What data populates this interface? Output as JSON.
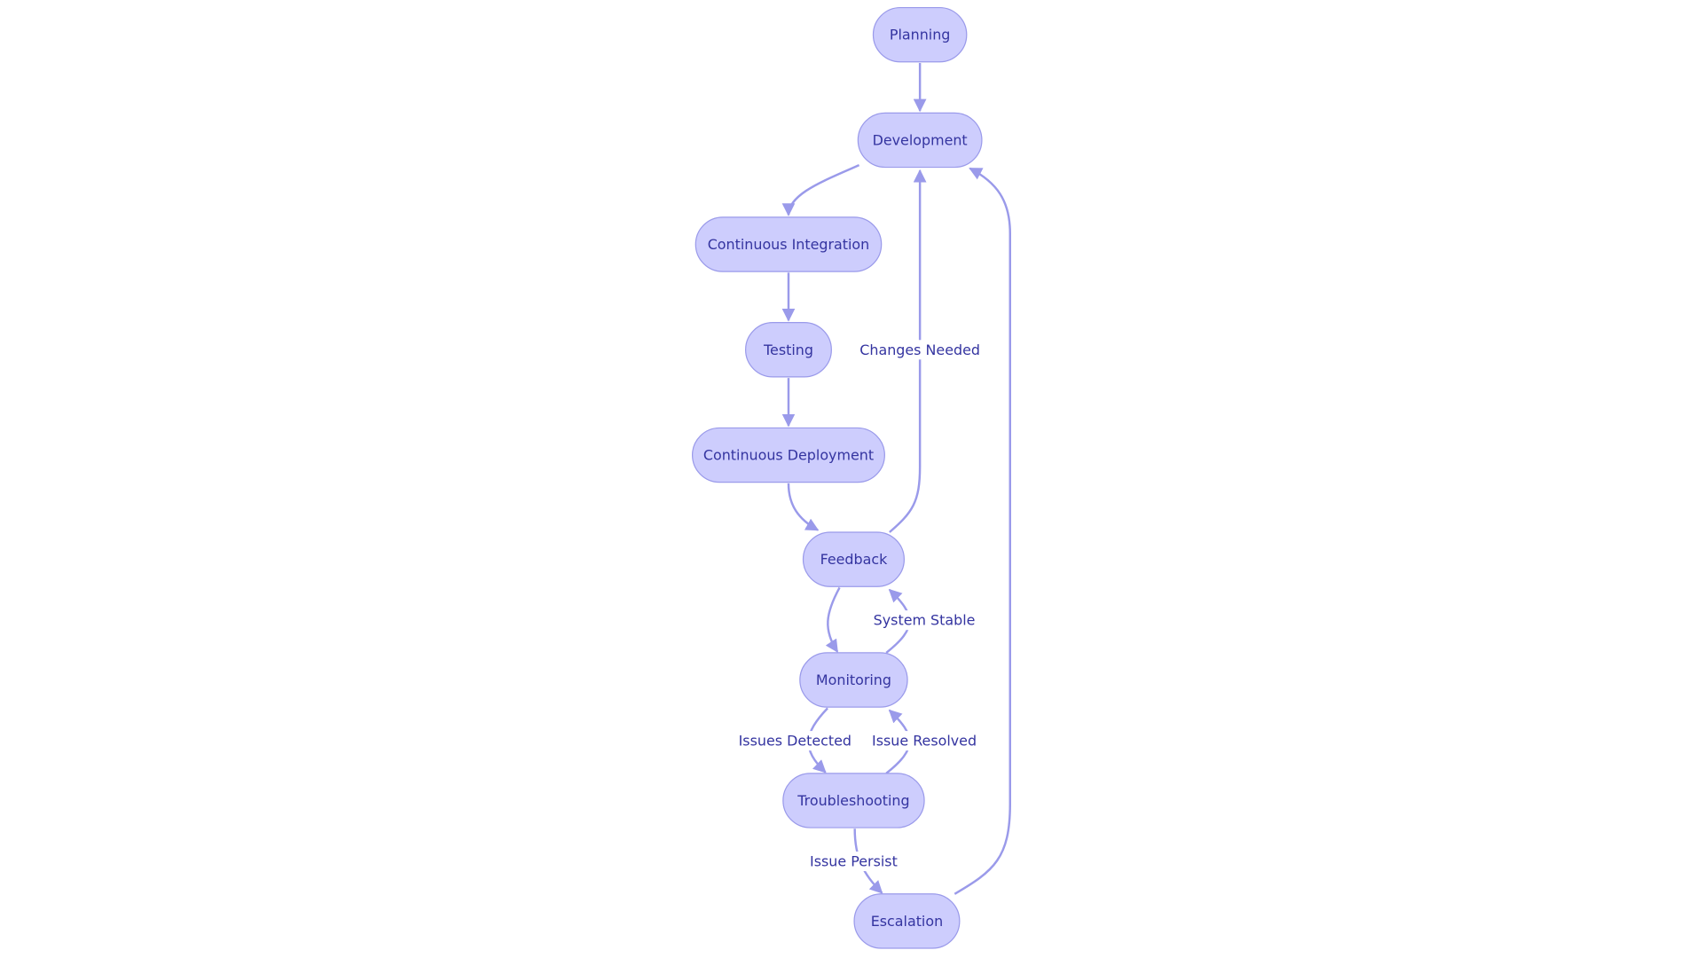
{
  "colors": {
    "node_fill": "#cdcdfd",
    "node_stroke": "#9a9aea",
    "text": "#3434a0",
    "edge": "#9a9aea"
  },
  "nodes": [
    {
      "id": "planning",
      "label": "Planning"
    },
    {
      "id": "development",
      "label": "Development"
    },
    {
      "id": "ci",
      "label": "Continuous Integration"
    },
    {
      "id": "testing",
      "label": "Testing"
    },
    {
      "id": "cd",
      "label": "Continuous Deployment"
    },
    {
      "id": "feedback",
      "label": "Feedback"
    },
    {
      "id": "monitoring",
      "label": "Monitoring"
    },
    {
      "id": "troubleshooting",
      "label": "Troubleshooting"
    },
    {
      "id": "escalation",
      "label": "Escalation"
    }
  ],
  "edges": [
    {
      "from": "planning",
      "to": "development",
      "label": ""
    },
    {
      "from": "development",
      "to": "ci",
      "label": ""
    },
    {
      "from": "ci",
      "to": "testing",
      "label": ""
    },
    {
      "from": "testing",
      "to": "cd",
      "label": ""
    },
    {
      "from": "cd",
      "to": "feedback",
      "label": ""
    },
    {
      "from": "feedback",
      "to": "development",
      "label": "Changes Needed"
    },
    {
      "from": "feedback",
      "to": "monitoring",
      "label": ""
    },
    {
      "from": "monitoring",
      "to": "feedback",
      "label": "System Stable"
    },
    {
      "from": "monitoring",
      "to": "troubleshooting",
      "label": "Issues Detected"
    },
    {
      "from": "troubleshooting",
      "to": "monitoring",
      "label": "Issue Resolved"
    },
    {
      "from": "troubleshooting",
      "to": "escalation",
      "label": "Issue Persist"
    },
    {
      "from": "escalation",
      "to": "development",
      "label": ""
    }
  ]
}
